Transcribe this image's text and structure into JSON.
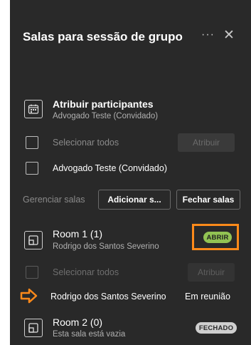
{
  "header": {
    "title": "Salas para sessão de grupo",
    "more_glyph": "···",
    "close_glyph": "✕"
  },
  "assign": {
    "title": "Atribuir participantes",
    "subtitle": "Advogado Teste (Convidado)",
    "select_all": "Selecionar todos",
    "assign_button": "Atribuir",
    "participant": "Advogado Teste (Convidado)"
  },
  "manage": {
    "label": "Gerenciar salas",
    "add_button": "Adicionar s...",
    "close_button": "Fechar salas"
  },
  "rooms": [
    {
      "name": "Room 1 (1)",
      "subtitle": "Rodrigo dos Santos Severino",
      "status": "ABRIR",
      "select_all": "Selecionar todos",
      "assign_button": "Atribuir",
      "member": "Rodrigo dos Santos Severino",
      "member_status": "Em reunião"
    },
    {
      "name": "Room 2 (0)",
      "subtitle": "Esta sala está vazia",
      "status": "FECHADO"
    }
  ],
  "colors": {
    "panel_bg": "#292929",
    "open_pill": "#92c353",
    "highlight": "#ff8a1a"
  },
  "icons": [
    "more-icon",
    "close-icon",
    "calendar-assign-icon",
    "room-icon",
    "arrow-right-icon"
  ]
}
